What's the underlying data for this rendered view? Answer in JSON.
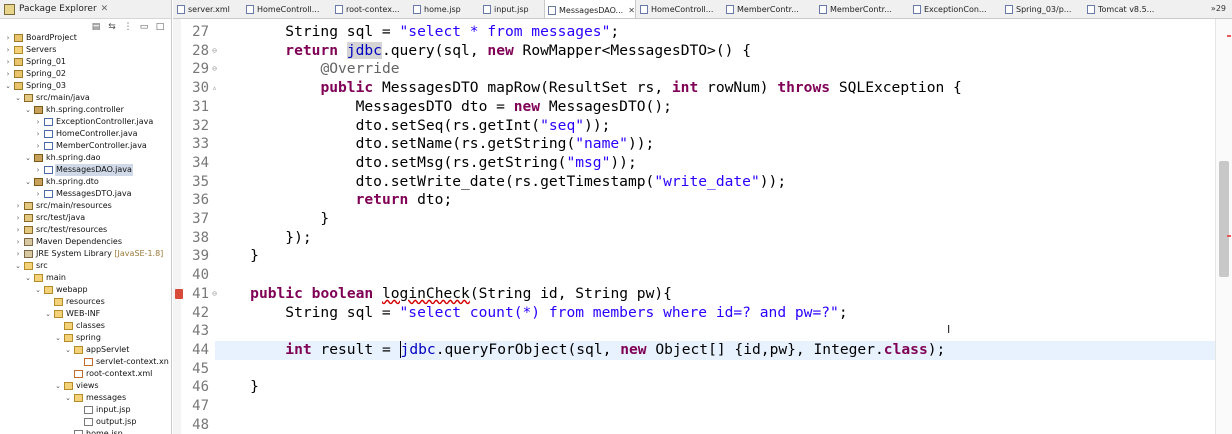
{
  "explorer": {
    "title": "Package Explorer",
    "close": "✕",
    "items": [
      {
        "label": "BoardProject",
        "indent": 0,
        "twisty": "›",
        "icon": "project"
      },
      {
        "label": "Servers",
        "indent": 0,
        "twisty": "›",
        "icon": "folder"
      },
      {
        "label": "Spring_01",
        "indent": 0,
        "twisty": "›",
        "icon": "project"
      },
      {
        "label": "Spring_02",
        "indent": 0,
        "twisty": "›",
        "icon": "project"
      },
      {
        "label": "Spring_03",
        "indent": 0,
        "twisty": "⌄",
        "icon": "project"
      },
      {
        "label": "src/main/java",
        "indent": 1,
        "twisty": "⌄",
        "icon": "src"
      },
      {
        "label": "kh.spring.controller",
        "indent": 2,
        "twisty": "⌄",
        "icon": "package"
      },
      {
        "label": "ExceptionController.java",
        "indent": 3,
        "twisty": "›",
        "icon": "java"
      },
      {
        "label": "HomeController.java",
        "indent": 3,
        "twisty": "›",
        "icon": "java"
      },
      {
        "label": "MemberController.java",
        "indent": 3,
        "twisty": "›",
        "icon": "java"
      },
      {
        "label": "kh.spring.dao",
        "indent": 2,
        "twisty": "⌄",
        "icon": "package"
      },
      {
        "label": "MessagesDAO.java",
        "indent": 3,
        "twisty": "›",
        "icon": "java",
        "selected": true
      },
      {
        "label": "kh.spring.dto",
        "indent": 2,
        "twisty": "⌄",
        "icon": "package"
      },
      {
        "label": "MessagesDTO.java",
        "indent": 3,
        "twisty": "›",
        "icon": "java"
      },
      {
        "label": "src/main/resources",
        "indent": 1,
        "twisty": "›",
        "icon": "src"
      },
      {
        "label": "src/test/java",
        "indent": 1,
        "twisty": "›",
        "icon": "src"
      },
      {
        "label": "src/test/resources",
        "indent": 1,
        "twisty": "›",
        "icon": "src"
      },
      {
        "label": "Maven Dependencies",
        "indent": 1,
        "twisty": "›",
        "icon": "lib"
      },
      {
        "label": "JRE System Library",
        "decor": " [JavaSE-1.8]",
        "indent": 1,
        "twisty": "›",
        "icon": "lib"
      },
      {
        "label": "src",
        "indent": 1,
        "twisty": "⌄",
        "icon": "folder"
      },
      {
        "label": "main",
        "indent": 2,
        "twisty": "⌄",
        "icon": "folder"
      },
      {
        "label": "webapp",
        "indent": 3,
        "twisty": "⌄",
        "icon": "folder"
      },
      {
        "label": "resources",
        "indent": 4,
        "twisty": "",
        "icon": "folder"
      },
      {
        "label": "WEB-INF",
        "indent": 4,
        "twisty": "⌄",
        "icon": "folder"
      },
      {
        "label": "classes",
        "indent": 5,
        "twisty": "",
        "icon": "folder"
      },
      {
        "label": "spring",
        "indent": 5,
        "twisty": "⌄",
        "icon": "folder"
      },
      {
        "label": "appServlet",
        "indent": 6,
        "twisty": "⌄",
        "icon": "folder"
      },
      {
        "label": "servlet-context.xn",
        "indent": 7,
        "twisty": "",
        "icon": "xml"
      },
      {
        "label": "root-context.xml",
        "indent": 6,
        "twisty": "",
        "icon": "xml"
      },
      {
        "label": "views",
        "indent": 5,
        "twisty": "⌄",
        "icon": "folder"
      },
      {
        "label": "messages",
        "indent": 6,
        "twisty": "⌄",
        "icon": "folder"
      },
      {
        "label": "input.jsp",
        "indent": 7,
        "twisty": "",
        "icon": "jsp"
      },
      {
        "label": "output.jsp",
        "indent": 7,
        "twisty": "",
        "icon": "jsp"
      },
      {
        "label": "home.jsp",
        "indent": 6,
        "twisty": "",
        "icon": "jsp"
      }
    ]
  },
  "tabs": [
    {
      "label": "server.xml",
      "close": ""
    },
    {
      "label": "HomeControll...",
      "close": ""
    },
    {
      "label": "root-contex...",
      "close": ""
    },
    {
      "label": "home.jsp",
      "close": ""
    },
    {
      "label": "input.jsp",
      "close": ""
    },
    {
      "label": "MessagesDAO...",
      "close": "✕",
      "active": true
    },
    {
      "label": "HomeControll...",
      "close": ""
    },
    {
      "label": "MemberContr...",
      "close": ""
    },
    {
      "label": "MemberContr...",
      "close": ""
    },
    {
      "label": "ExceptionCon...",
      "close": ""
    },
    {
      "label": "Spring_03/p...",
      "close": ""
    },
    {
      "label": "Tomcat v8.5...",
      "close": ""
    }
  ],
  "tab_overflow": "»29",
  "lines": [
    {
      "n": "27",
      "fold": "",
      "parts": [
        [
          "pln",
          "        String sql = "
        ],
        [
          "str",
          "\"select * from messages\""
        ],
        [
          "pln",
          ";"
        ]
      ]
    },
    {
      "n": "28",
      "fold": "⊖",
      "parts": [
        [
          "pln",
          "        "
        ],
        [
          "kw",
          "return"
        ],
        [
          "pln",
          " "
        ],
        [
          "fldhl",
          "jdbc"
        ],
        [
          "pln",
          ".query(sql, "
        ],
        [
          "kw",
          "new"
        ],
        [
          "pln",
          " RowMapper<MessagesDTO>() {"
        ]
      ]
    },
    {
      "n": "29",
      "fold": "⊖",
      "parts": [
        [
          "pln",
          "            "
        ],
        [
          "ann",
          "@Override"
        ]
      ]
    },
    {
      "n": "30",
      "fold": "",
      "marker": "▵",
      "parts": [
        [
          "pln",
          "            "
        ],
        [
          "kw",
          "public"
        ],
        [
          "pln",
          " MessagesDTO mapRow(ResultSet rs, "
        ],
        [
          "kw",
          "int"
        ],
        [
          "pln",
          " rowNum) "
        ],
        [
          "kw",
          "throws"
        ],
        [
          "pln",
          " SQLException {"
        ]
      ]
    },
    {
      "n": "31",
      "fold": "",
      "parts": [
        [
          "pln",
          "                MessagesDTO dto = "
        ],
        [
          "kw",
          "new"
        ],
        [
          "pln",
          " MessagesDTO();"
        ]
      ]
    },
    {
      "n": "32",
      "fold": "",
      "parts": [
        [
          "pln",
          "                dto.setSeq(rs.getInt("
        ],
        [
          "str",
          "\"seq\""
        ],
        [
          "pln",
          "));"
        ]
      ]
    },
    {
      "n": "33",
      "fold": "",
      "parts": [
        [
          "pln",
          "                dto.setName(rs.getString("
        ],
        [
          "str",
          "\"name\""
        ],
        [
          "pln",
          "));"
        ]
      ]
    },
    {
      "n": "34",
      "fold": "",
      "parts": [
        [
          "pln",
          "                dto.setMsg(rs.getString("
        ],
        [
          "str",
          "\"msg\""
        ],
        [
          "pln",
          "));"
        ]
      ]
    },
    {
      "n": "35",
      "fold": "",
      "parts": [
        [
          "pln",
          "                dto.setWrite_date(rs.getTimestamp("
        ],
        [
          "str",
          "\"write_date\""
        ],
        [
          "pln",
          "));"
        ]
      ]
    },
    {
      "n": "36",
      "fold": "",
      "parts": [
        [
          "pln",
          "                "
        ],
        [
          "kw",
          "return"
        ],
        [
          "pln",
          " dto;"
        ]
      ]
    },
    {
      "n": "37",
      "fold": "",
      "parts": [
        [
          "pln",
          "            }"
        ]
      ]
    },
    {
      "n": "38",
      "fold": "",
      "parts": [
        [
          "pln",
          "        });"
        ]
      ]
    },
    {
      "n": "39",
      "fold": "",
      "parts": [
        [
          "pln",
          "    }"
        ]
      ]
    },
    {
      "n": "40",
      "fold": "",
      "parts": []
    },
    {
      "n": "41",
      "fold": "⊖",
      "bp": true,
      "parts": [
        [
          "pln",
          "    "
        ],
        [
          "kw",
          "public"
        ],
        [
          "pln",
          " "
        ],
        [
          "kw",
          "boolean"
        ],
        [
          "pln",
          " "
        ],
        [
          "sq",
          "loginCheck"
        ],
        [
          "pln",
          "(String id, String pw){"
        ]
      ]
    },
    {
      "n": "42",
      "fold": "",
      "parts": [
        [
          "pln",
          "        String sql = "
        ],
        [
          "str",
          "\"select count(*) from members where id=? and pw=?\""
        ],
        [
          "pln",
          ";"
        ]
      ]
    },
    {
      "n": "43",
      "fold": "",
      "parts": []
    },
    {
      "n": "44",
      "fold": "",
      "current": true,
      "parts": [
        [
          "pln",
          "        "
        ],
        [
          "kw",
          "int"
        ],
        [
          "pln",
          " result = "
        ],
        [
          "caretfld",
          "jdbc"
        ],
        [
          "pln",
          ".queryForObject(sql, "
        ],
        [
          "kw",
          "new"
        ],
        [
          "pln",
          " Object[] {id,pw}, Integer."
        ],
        [
          "kw",
          "class"
        ],
        [
          "pln",
          ");"
        ]
      ]
    },
    {
      "n": "45",
      "fold": "",
      "parts": []
    },
    {
      "n": "46",
      "fold": "",
      "parts": [
        [
          "pln",
          "    }"
        ]
      ]
    },
    {
      "n": "47",
      "fold": "",
      "parts": []
    },
    {
      "n": "48",
      "fold": "",
      "parts": []
    }
  ],
  "mouse_cursor": "I"
}
